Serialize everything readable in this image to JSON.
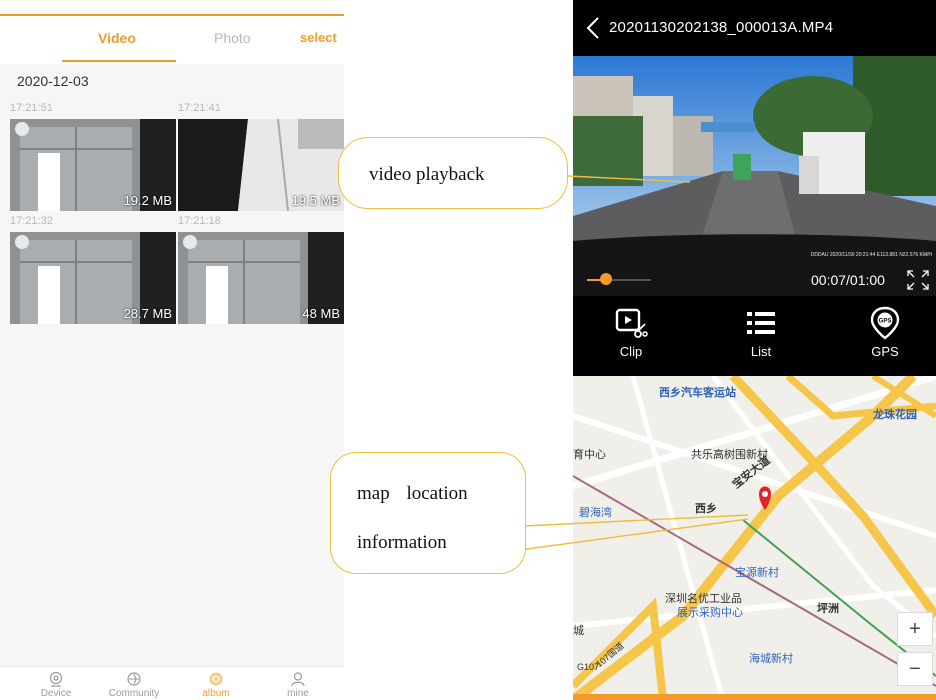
{
  "album": {
    "tabs": {
      "video": "Video",
      "photo": "Photo",
      "select": "select"
    },
    "date": "2020-12-03",
    "thumbnails": [
      {
        "time": "17:21:51",
        "size": "19.2 MB"
      },
      {
        "time": "17:21:41",
        "size": "19.5 MB"
      },
      {
        "time": "17:21:32",
        "size": "28.7 MB"
      },
      {
        "time": "17:21:18",
        "size": "48 MB"
      }
    ],
    "nav": [
      {
        "label": "Device",
        "icon": "camera-icon"
      },
      {
        "label": "Community",
        "icon": "community-icon"
      },
      {
        "label": "album",
        "icon": "album-icon",
        "active": true
      },
      {
        "label": "mine",
        "icon": "person-icon"
      }
    ]
  },
  "playback": {
    "title": "20201130202138_000013A.MP4",
    "overlay_text": "DDDAU 2020/11/30 20:21:44 E113.881 N22.576 KM/H",
    "progress": 0.3,
    "time": "00:07/01:00",
    "actions": [
      {
        "label": "Clip",
        "icon": "clip-icon"
      },
      {
        "label": "List",
        "icon": "list-icon"
      },
      {
        "label": "GPS",
        "icon": "gps-pin-icon"
      }
    ]
  },
  "map": {
    "labels": {
      "bus_station": "西乡汽车客运站",
      "longzhu": "龙珠花园",
      "sports_center": "育中心",
      "gongle": "共乐高树围新村",
      "xixiang": "西乡",
      "bihaiwan": "碧海湾",
      "road": "宝安大道",
      "baoyuan": "宝源新村",
      "shenzhen_1": "深圳名优工业品",
      "shenzhen_2": "展示采购中心",
      "pingzhou": "坪洲",
      "cheng": "城",
      "haicheng": "海城新村",
      "g107": "G107",
      "highway": "107国道"
    },
    "zoom_in": "+",
    "zoom_out": "−"
  },
  "annotations": {
    "video_playback": "video playback",
    "map_line1": "map location",
    "map_line2": "information"
  },
  "colors": {
    "accent": "#f29a2e",
    "callout_border": "#f0be3f",
    "pin": "#e2242a"
  }
}
